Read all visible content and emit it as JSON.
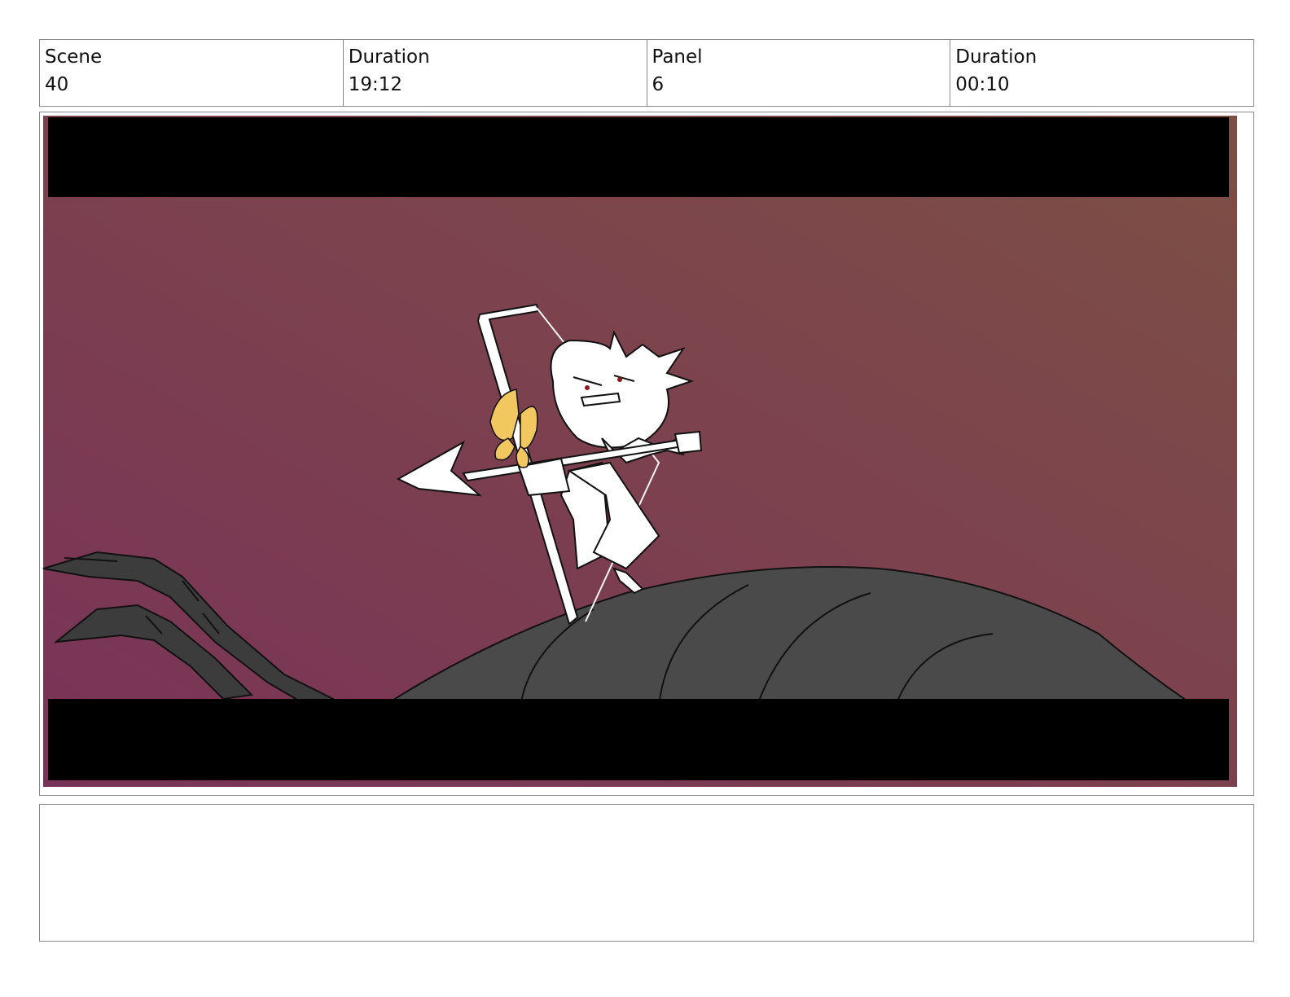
{
  "header": {
    "scene": {
      "label": "Scene",
      "value": "40"
    },
    "scene_duration": {
      "label": "Duration",
      "value": "19:12"
    },
    "panel": {
      "label": "Panel",
      "value": "6"
    },
    "panel_duration": {
      "label": "Duration",
      "value": "00:10"
    }
  },
  "panel_art": {
    "depicts": [
      "character-with-bow",
      "arrow",
      "butterfly",
      "giant-insect-body",
      "insect-legs"
    ],
    "colors": {
      "letterbox": "#000000",
      "background_left": "#7a3358",
      "background_right": "#7d4f44",
      "insect_body": "#4a4a4a",
      "butterfly": "#f3c760",
      "line_art": "#111111",
      "character_fill": "#ffffff"
    }
  },
  "notes": {
    "text": ""
  }
}
